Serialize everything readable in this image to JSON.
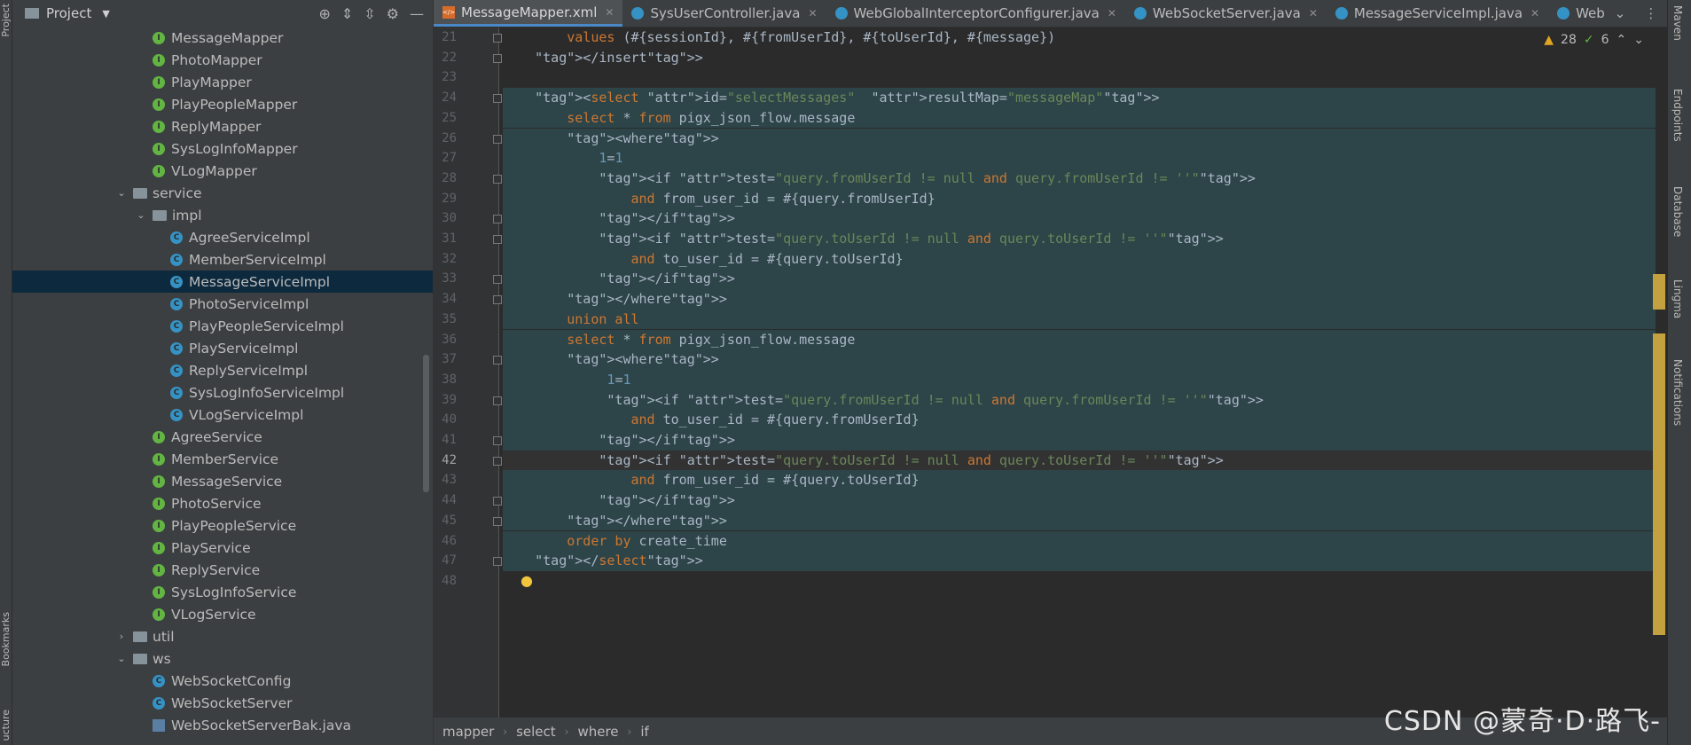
{
  "left_strip": {
    "project_label": "Project",
    "bookmarks_label": "Bookmarks",
    "structure_label": "ucture"
  },
  "project_panel": {
    "title": "Project",
    "tree": [
      {
        "label": "MessageMapper",
        "icon": "interface",
        "depth": 4
      },
      {
        "label": "PhotoMapper",
        "icon": "interface",
        "depth": 4
      },
      {
        "label": "PlayMapper",
        "icon": "interface",
        "depth": 4
      },
      {
        "label": "PlayPeopleMapper",
        "icon": "interface",
        "depth": 4
      },
      {
        "label": "ReplyMapper",
        "icon": "interface",
        "depth": 4
      },
      {
        "label": "SysLogInfoMapper",
        "icon": "interface",
        "depth": 4
      },
      {
        "label": "VLogMapper",
        "icon": "interface",
        "depth": 4
      },
      {
        "label": "service",
        "icon": "folder",
        "depth": 3,
        "expanded": true
      },
      {
        "label": "impl",
        "icon": "folder",
        "depth": 4,
        "expanded": true
      },
      {
        "label": "AgreeServiceImpl",
        "icon": "class",
        "depth": 5
      },
      {
        "label": "MemberServiceImpl",
        "icon": "class",
        "depth": 5
      },
      {
        "label": "MessageServiceImpl",
        "icon": "class",
        "depth": 5,
        "selected": true
      },
      {
        "label": "PhotoServiceImpl",
        "icon": "class",
        "depth": 5
      },
      {
        "label": "PlayPeopleServiceImpl",
        "icon": "class",
        "depth": 5
      },
      {
        "label": "PlayServiceImpl",
        "icon": "class",
        "depth": 5
      },
      {
        "label": "ReplyServiceImpl",
        "icon": "class",
        "depth": 5
      },
      {
        "label": "SysLogInfoServiceImpl",
        "icon": "class",
        "depth": 5
      },
      {
        "label": "VLogServiceImpl",
        "icon": "class",
        "depth": 5
      },
      {
        "label": "AgreeService",
        "icon": "interface",
        "depth": 4
      },
      {
        "label": "MemberService",
        "icon": "interface",
        "depth": 4
      },
      {
        "label": "MessageService",
        "icon": "interface",
        "depth": 4
      },
      {
        "label": "PhotoService",
        "icon": "interface",
        "depth": 4
      },
      {
        "label": "PlayPeopleService",
        "icon": "interface",
        "depth": 4
      },
      {
        "label": "PlayService",
        "icon": "interface",
        "depth": 4
      },
      {
        "label": "ReplyService",
        "icon": "interface",
        "depth": 4
      },
      {
        "label": "SysLogInfoService",
        "icon": "interface",
        "depth": 4
      },
      {
        "label": "VLogService",
        "icon": "interface",
        "depth": 4
      },
      {
        "label": "util",
        "icon": "folder",
        "depth": 3,
        "expanded": false
      },
      {
        "label": "ws",
        "icon": "folder",
        "depth": 3,
        "expanded": true
      },
      {
        "label": "WebSocketConfig",
        "icon": "class",
        "depth": 4
      },
      {
        "label": "WebSocketServer",
        "icon": "class",
        "depth": 4
      },
      {
        "label": "WebSocketServerBak.java",
        "icon": "java-file",
        "depth": 4
      }
    ]
  },
  "tabs": [
    {
      "label": "MessageMapper.xml",
      "icon": "xml",
      "active": true
    },
    {
      "label": "SysUserController.java",
      "icon": "class",
      "active": false
    },
    {
      "label": "WebGlobalInterceptorConfigurer.java",
      "icon": "class",
      "active": false
    },
    {
      "label": "WebSocketServer.java",
      "icon": "class",
      "active": false
    },
    {
      "label": "MessageServiceImpl.java",
      "icon": "class",
      "active": false
    },
    {
      "label": "Web",
      "icon": "class",
      "active": false
    }
  ],
  "inspection": {
    "warnings": "28",
    "ok": "6"
  },
  "editor": {
    "current_line": "42",
    "lines": [
      {
        "n": "21",
        "text": "        values (#{sessionId}, #{fromUserId}, #{toUserId}, #{message})"
      },
      {
        "n": "22",
        "text": "    </insert>"
      },
      {
        "n": "23",
        "text": ""
      },
      {
        "n": "24",
        "text": "    <select id=\"selectMessages\"  resultMap=\"messageMap\">"
      },
      {
        "n": "25",
        "text": "        select * from pigx_json_flow.message"
      },
      {
        "n": "26",
        "text": "        <where>"
      },
      {
        "n": "27",
        "text": "            1=1"
      },
      {
        "n": "28",
        "text": "            <if test=\"query.fromUserId != null and query.fromUserId != ''\">"
      },
      {
        "n": "29",
        "text": "                and from_user_id = #{query.fromUserId}"
      },
      {
        "n": "30",
        "text": "            </if>"
      },
      {
        "n": "31",
        "text": "            <if test=\"query.toUserId != null and query.toUserId != ''\">"
      },
      {
        "n": "32",
        "text": "                and to_user_id = #{query.toUserId}"
      },
      {
        "n": "33",
        "text": "            </if>"
      },
      {
        "n": "34",
        "text": "        </where>"
      },
      {
        "n": "35",
        "text": "        union all"
      },
      {
        "n": "36",
        "text": "        select * from pigx_json_flow.message"
      },
      {
        "n": "37",
        "text": "        <where>"
      },
      {
        "n": "38",
        "text": "             1=1"
      },
      {
        "n": "39",
        "text": "             <if test=\"query.fromUserId != null and query.fromUserId != ''\">"
      },
      {
        "n": "40",
        "text": "                and to_user_id = #{query.fromUserId}"
      },
      {
        "n": "41",
        "text": "            </if>"
      },
      {
        "n": "42",
        "text": "            <if test=\"query.toUserId != null and query.toUserId != ''\">"
      },
      {
        "n": "43",
        "text": "                and from_user_id = #{query.toUserId}"
      },
      {
        "n": "44",
        "text": "            </if>"
      },
      {
        "n": "45",
        "text": "        </where>"
      },
      {
        "n": "46",
        "text": "        order by create_time"
      },
      {
        "n": "47",
        "text": "    </select>"
      },
      {
        "n": "48",
        "text": ""
      }
    ]
  },
  "breadcrumbs": [
    "mapper",
    "select",
    "where",
    "if"
  ],
  "right_strip": {
    "maven": "Maven",
    "endpoints": "Endpoints",
    "database": "Database",
    "lingma": "Lingma",
    "notifications": "Notifications"
  },
  "watermark": "CSDN @蒙奇·D·路飞-",
  "colors": {
    "accent": "#4a88c7",
    "panel": "#3c3f41",
    "editor_bg": "#2b2b2b",
    "tag": "#e8bf6a",
    "string": "#6a8759",
    "keyword": "#cc7832",
    "number": "#6897bb",
    "marker": "#c3a13f"
  }
}
